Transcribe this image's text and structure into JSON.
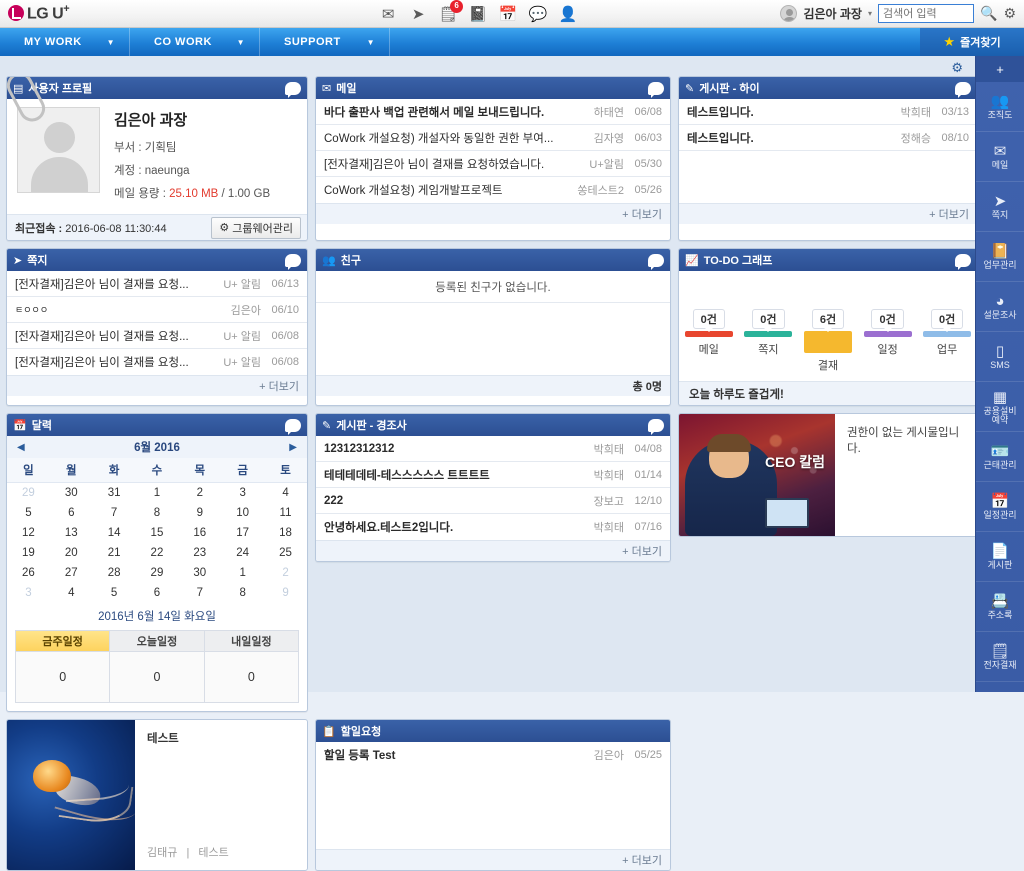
{
  "brand": {
    "name": "LG U",
    "sup": "+"
  },
  "topbar": {
    "icons": [
      {
        "name": "mail-icon",
        "glyph": "✉",
        "badge": null
      },
      {
        "name": "cursor-icon",
        "glyph": "➤",
        "badge": null
      },
      {
        "name": "approval-icon",
        "glyph": "🗒",
        "badge": "6"
      },
      {
        "name": "board-icon",
        "glyph": "📓",
        "badge": null
      },
      {
        "name": "calendar-icon",
        "glyph": "📅",
        "badge": null
      },
      {
        "name": "chat-icon",
        "glyph": "💬",
        "badge": null
      },
      {
        "name": "contacts-icon",
        "glyph": "👤",
        "badge": null
      }
    ],
    "user": "김은아 과장",
    "search_placeholder": "검색어 입력",
    "search_value": ""
  },
  "nav": {
    "items": [
      {
        "label": "MY WORK"
      },
      {
        "label": "CO WORK"
      },
      {
        "label": "SUPPORT"
      }
    ],
    "favorites": "즐겨찾기"
  },
  "profile": {
    "title": "사용자 프로필",
    "name": "김은아 과장",
    "dept_label": "부서 : ",
    "dept_value": "기획팀",
    "account_label": "계정 : ",
    "account_value": "naeunga",
    "quota_label": "메일 용량 : ",
    "quota_used": "25.10 MB",
    "quota_total": " / 1.00 GB",
    "last_login_label": "최근접속 : ",
    "last_login_value": "2016-06-08 11:30:44",
    "manage_button": "그룹웨어관리"
  },
  "mail": {
    "title": "메일",
    "rows": [
      {
        "title": "바다 출판사 백업 관련해서 메일 보내드립니다.",
        "who": "하태연",
        "date": "06/08"
      },
      {
        "title": "CoWork 개설요청) 개설자와 동일한 권한 부여...",
        "who": "김자영",
        "date": "06/03"
      },
      {
        "title": "[전자결재]김은아 님이 결재를 요청하였습니다.",
        "who": "U+알림",
        "date": "05/30"
      },
      {
        "title": "CoWork 개설요청) 게임개발프로젝트",
        "who": "쏭테스트2",
        "date": "05/26"
      }
    ],
    "more": "+ 더보기"
  },
  "board_hi": {
    "title": "게시판 - 하이",
    "rows": [
      {
        "title": "테스트입니다.",
        "who": "박희태",
        "date": "03/13"
      },
      {
        "title": "테스트입니다.",
        "who": "정해승",
        "date": "08/10"
      }
    ],
    "more": "+ 더보기"
  },
  "note": {
    "title": "쪽지",
    "rows": [
      {
        "title": "[전자결재]김은아 님이 결재를 요청...",
        "who": "U+ 알림",
        "date": "06/13"
      },
      {
        "title": "ㅌㅇㅇㅇ",
        "who": "김은아",
        "date": "06/10"
      },
      {
        "title": "[전자결재]김은아 님이 결재를 요청...",
        "who": "U+ 알림",
        "date": "06/08"
      },
      {
        "title": "[전자결재]김은아 님이 결재를 요청...",
        "who": "U+ 알림",
        "date": "06/08"
      }
    ],
    "more": "+ 더보기"
  },
  "friends": {
    "title": "친구",
    "empty": "등록된 친구가 없습니다.",
    "total": "총 0명"
  },
  "todo": {
    "title": "TO-DO 그래프",
    "footer": "오늘 하루도 즐겁게!",
    "message": "오늘 하루도 즐겁게!"
  },
  "chart_data": {
    "type": "bar",
    "title": "TO-DO 그래프",
    "categories": [
      "메일",
      "쪽지",
      "결재",
      "일정",
      "업무"
    ],
    "values": [
      0,
      0,
      6,
      0,
      0
    ],
    "value_labels": [
      "0건",
      "0건",
      "6건",
      "0건",
      "0건"
    ],
    "colors": [
      "#e8462f",
      "#2bb39a",
      "#f5b82e",
      "#9b6fd0",
      "#8fbce8"
    ],
    "xlabel": "",
    "ylabel": "",
    "ylim": [
      0,
      6
    ],
    "grid": false,
    "legend": false
  },
  "calendar": {
    "title": "달력",
    "month_label": "6월 2016",
    "prev": "◀",
    "next": "▶",
    "weekdays": [
      "일",
      "월",
      "화",
      "수",
      "목",
      "금",
      "토"
    ],
    "weeks": [
      [
        {
          "d": "29",
          "m": true
        },
        {
          "d": "30",
          "m": true
        },
        {
          "d": "31",
          "m": true
        },
        {
          "d": "1",
          "m": false
        },
        {
          "d": "2",
          "m": false
        },
        {
          "d": "3",
          "m": false
        },
        {
          "d": "4",
          "m": false
        }
      ],
      [
        {
          "d": "5",
          "m": false
        },
        {
          "d": "6",
          "m": false
        },
        {
          "d": "7",
          "m": false
        },
        {
          "d": "8",
          "m": false
        },
        {
          "d": "9",
          "m": false
        },
        {
          "d": "10",
          "m": false
        },
        {
          "d": "11",
          "m": false
        }
      ],
      [
        {
          "d": "12",
          "m": false
        },
        {
          "d": "13",
          "m": false
        },
        {
          "d": "14",
          "m": false
        },
        {
          "d": "15",
          "m": false
        },
        {
          "d": "16",
          "m": false
        },
        {
          "d": "17",
          "m": false
        },
        {
          "d": "18",
          "m": false
        }
      ],
      [
        {
          "d": "19",
          "m": false
        },
        {
          "d": "20",
          "m": false
        },
        {
          "d": "21",
          "m": false
        },
        {
          "d": "22",
          "m": false
        },
        {
          "d": "23",
          "m": false
        },
        {
          "d": "24",
          "m": false
        },
        {
          "d": "25",
          "m": false
        }
      ],
      [
        {
          "d": "26",
          "m": false
        },
        {
          "d": "27",
          "m": false
        },
        {
          "d": "28",
          "m": false
        },
        {
          "d": "29",
          "m": false
        },
        {
          "d": "30",
          "m": false
        },
        {
          "d": "1",
          "m": true
        },
        {
          "d": "2",
          "m": true
        }
      ],
      [
        {
          "d": "3",
          "m": true
        },
        {
          "d": "4",
          "m": true
        },
        {
          "d": "5",
          "m": true
        },
        {
          "d": "6",
          "m": true
        },
        {
          "d": "7",
          "m": true
        },
        {
          "d": "8",
          "m": true
        },
        {
          "d": "9",
          "m": true
        }
      ]
    ],
    "today_label": "2016년 6월 14일 화요일",
    "tabs": [
      {
        "label": "금주일정",
        "value": "0",
        "active": true
      },
      {
        "label": "오늘일정",
        "value": "0",
        "active": false
      },
      {
        "label": "내일일정",
        "value": "0",
        "active": false
      }
    ]
  },
  "board_condolence": {
    "title": "게시판 - 경조사",
    "rows": [
      {
        "title": "12312312312",
        "who": "박희태",
        "date": "04/08"
      },
      {
        "title": "테테테데테-테스스스스스 트트트트",
        "who": "박희태",
        "date": "01/14"
      },
      {
        "title": "222",
        "who": "장보고",
        "date": "12/10"
      },
      {
        "title": "안녕하세요.테스트2입니다.",
        "who": "박희태",
        "date": "07/16"
      }
    ],
    "more": "+ 더보기"
  },
  "ceo_card": {
    "image_label": "CEO 칼럼",
    "message": "권한이 없는 게시물입니다."
  },
  "jelly_card": {
    "title": "테스트",
    "author": "김태규",
    "category": "테스트"
  },
  "task_request": {
    "title": "할일요청",
    "rows": [
      {
        "title": "할일 등록 Test",
        "who": "김은아",
        "date": "05/25"
      }
    ],
    "more": "+ 더보기"
  },
  "sidebar": {
    "add": "+",
    "items": [
      {
        "label": "조직도",
        "icon": "org-chart-icon",
        "glyph": "👥"
      },
      {
        "label": "메일",
        "icon": "mail-icon",
        "glyph": "✉"
      },
      {
        "label": "쪽지",
        "icon": "note-icon",
        "glyph": "➤"
      },
      {
        "label": "업무관리",
        "icon": "task-icon",
        "glyph": "📔"
      },
      {
        "label": "설문조사",
        "icon": "survey-icon",
        "glyph": "◕"
      },
      {
        "label": "SMS",
        "icon": "sms-icon",
        "glyph": "▯"
      },
      {
        "label": "공용설비\n예약",
        "icon": "facility-icon",
        "glyph": "▦"
      },
      {
        "label": "근태관리",
        "icon": "attendance-icon",
        "glyph": "🪪"
      },
      {
        "label": "일정관리",
        "icon": "schedule-icon",
        "glyph": "📅"
      },
      {
        "label": "게시판",
        "icon": "board-icon",
        "glyph": "📄"
      },
      {
        "label": "주소록",
        "icon": "addressbook-icon",
        "glyph": "📇"
      },
      {
        "label": "전자결재",
        "icon": "approval-icon",
        "glyph": "🗒"
      }
    ]
  },
  "colors": {
    "nav_blue": "#1e7fd6",
    "panel_header": "#2c4f93",
    "accent_red": "#e23b2e",
    "sidebar": "#3f62ad"
  }
}
